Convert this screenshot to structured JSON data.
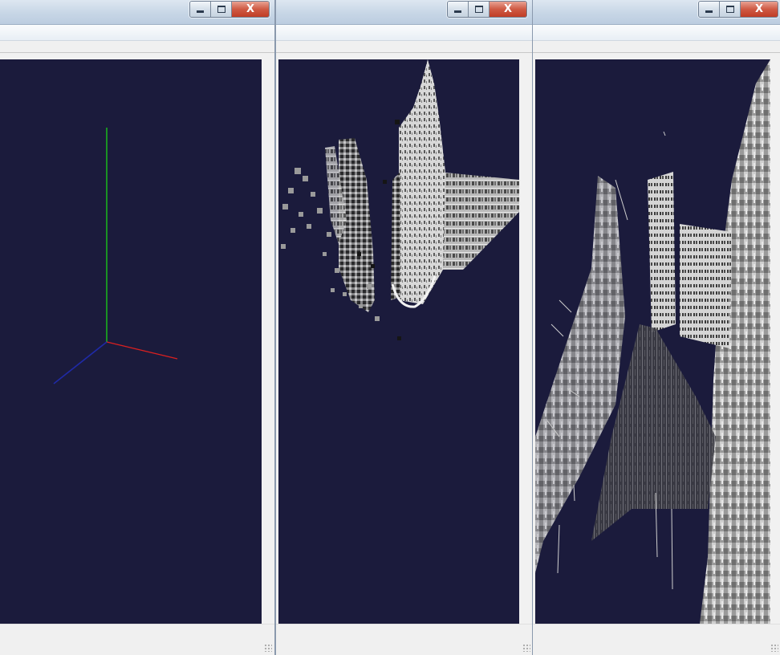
{
  "windows": [
    {
      "id": "left",
      "title": "",
      "view": "coordinate-axes",
      "axes": {
        "x_color": "#d92020",
        "y_color": "#19c419",
        "z_color": "#1f2aa6"
      },
      "viewport_bg": "#1b1b3c"
    },
    {
      "id": "middle",
      "title": "",
      "view": "voxel-building-reconstruction",
      "viewport_bg": "#1b1b3c"
    },
    {
      "id": "right",
      "title": "",
      "view": "street-scene-reconstruction",
      "viewport_bg": "#1b1b3c"
    }
  ],
  "caption_buttons": {
    "minimize": "",
    "maximize": "",
    "close": "X"
  },
  "icons": [
    "minimize-icon",
    "maximize-icon",
    "close-icon",
    "resize-grip-icon"
  ]
}
